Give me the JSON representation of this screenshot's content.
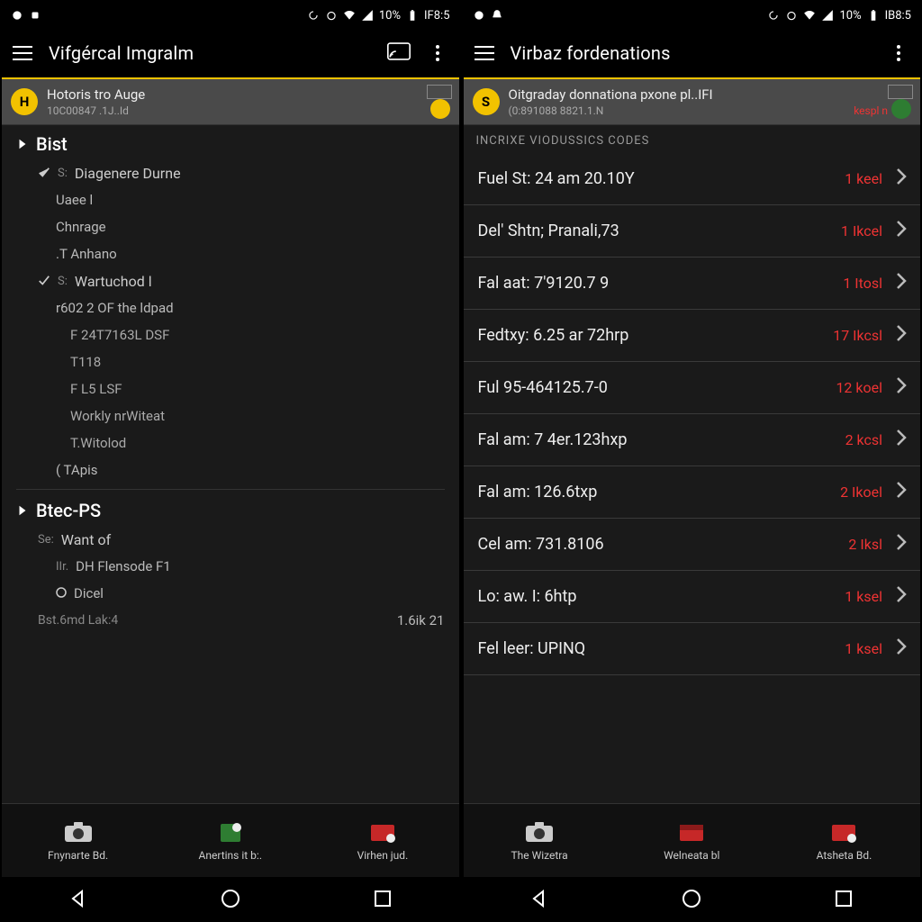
{
  "left": {
    "status": {
      "battery_pct": "10%",
      "clock": "IF8:5"
    },
    "app_title": "Vifgércal Imgralm",
    "banner": {
      "title": "Hotoris tro Auge",
      "subtitle": "10C00847 .1J..Id",
      "badge_letter": "H"
    },
    "tree": {
      "group1": "Bist",
      "g1_items": {
        "a": "Diagenere Durne",
        "a1": "Uaee l",
        "a2": "Chnrage",
        "a3": ".T Anhano",
        "b": "Wartuchod l",
        "b1": "r602 2 OF the ldpad",
        "b2": "F 24T7163L DSF",
        "b3": "T118",
        "b4": "F L5 LSF",
        "b5": "Workly nrWiteat",
        "b6": "T.Witolod",
        "c": "( TApis"
      },
      "group2": "Btec-PS",
      "g2_items": {
        "a": "Want of",
        "a1": "DH Flensode F1",
        "a2": "Dicel",
        "foot_l": "Bst.6md   Lak:4",
        "foot_r": "1.6ik 21"
      }
    },
    "actions": {
      "a": "Fnynarte Bd.",
      "b": "Anertins it b:.",
      "c": "Virhen jud."
    }
  },
  "right": {
    "status": {
      "battery_pct": "10%",
      "clock": "IB8:5"
    },
    "app_title": "Virbaz fordenations",
    "banner": {
      "title": "Oitgraday donnationa pxone pl..IFI",
      "subtitle": "(0:891088 8821.1.N",
      "badge_letter": "S",
      "keyword": "kespl n"
    },
    "section_caption": "INCRIXE VIODUSSICS CODES",
    "codes": [
      {
        "label": "Fuel St: 24 am 20.10Y",
        "badge": "1 keel"
      },
      {
        "label": "Del' Shtn; Pranali,73",
        "badge": "1 Ikcel"
      },
      {
        "label": "Fal aat: 7'9120.7 9",
        "badge": "1 Itosl"
      },
      {
        "label": "Fedtxy: 6.25 ar 72hrp",
        "badge": "17 Ikcsl"
      },
      {
        "label": "Ful 95-464125.7-0",
        "badge": "12 koel"
      },
      {
        "label": "Fal am: 7 4er.123hxp",
        "badge": "2 kcsl"
      },
      {
        "label": "Fal am: 126.6txp",
        "badge": "2 Ikoel"
      },
      {
        "label": "Cel am: 731.8106",
        "badge": "2 Iksl"
      },
      {
        "label": "Lo: aw. I: 6htp",
        "badge": "1 ksel"
      },
      {
        "label": "Fel leer: UPINQ",
        "badge": "1 ksel"
      }
    ],
    "actions": {
      "a": "The Wizetra",
      "b": "Welneata bl",
      "c": "Atsheta Bd."
    }
  }
}
